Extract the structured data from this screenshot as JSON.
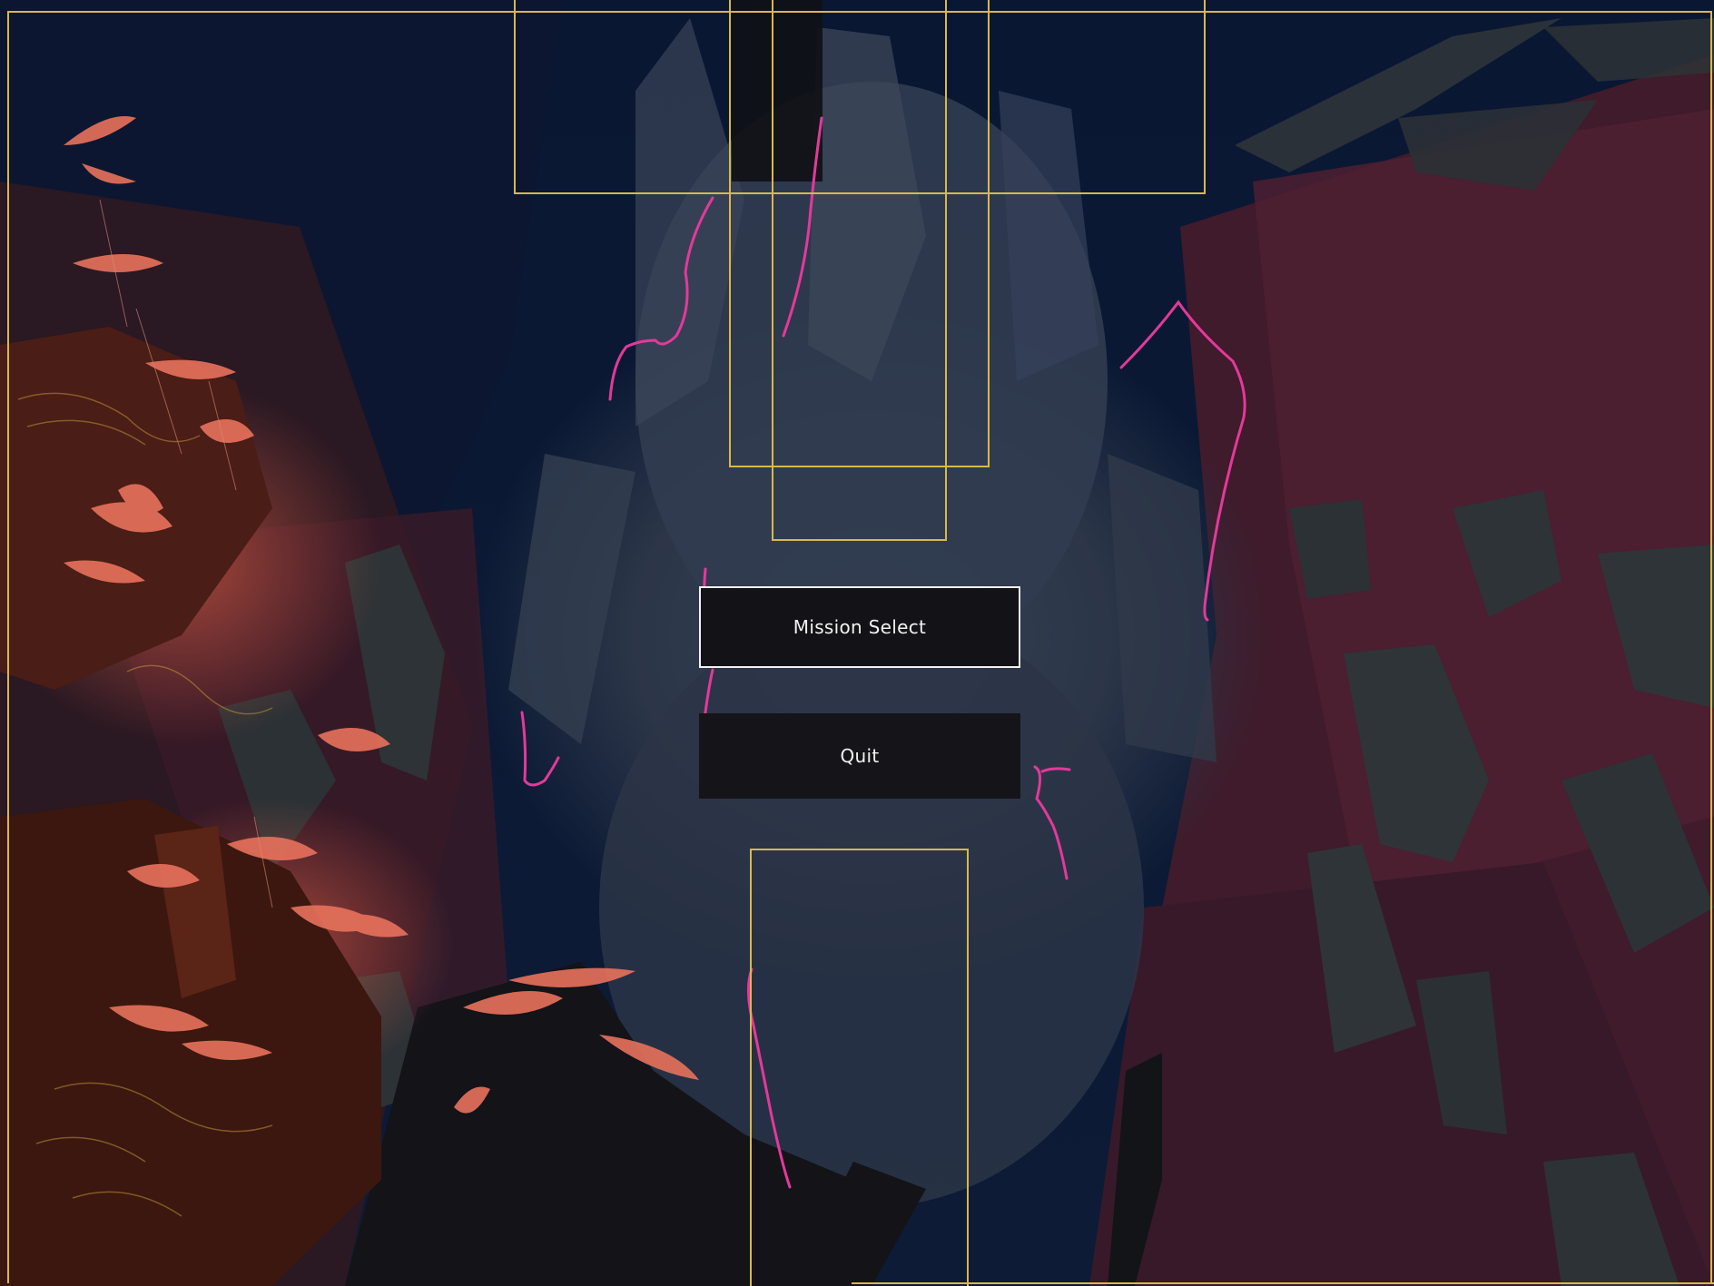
{
  "main_menu": {
    "buttons": [
      {
        "id": "mission_select",
        "label": "Mission Select",
        "focused": true
      },
      {
        "id": "quit",
        "label": "Quit",
        "focused": false
      }
    ]
  },
  "colors": {
    "debug_outline": "#d8b84a",
    "button_bg": "#151419",
    "button_text": "#f2f2f2",
    "focus_border": "#f2f2f2",
    "crack_glow": "#e4399a",
    "sky_navy": "#0b1a38",
    "rock_crimson": "#4a1e2e",
    "mist_slate": "#2f3a4c",
    "coral_leaves": "#e8725c"
  },
  "icons": [
    "painted-cavern-background",
    "glowing-crack-lines",
    "coral-foliage"
  ]
}
